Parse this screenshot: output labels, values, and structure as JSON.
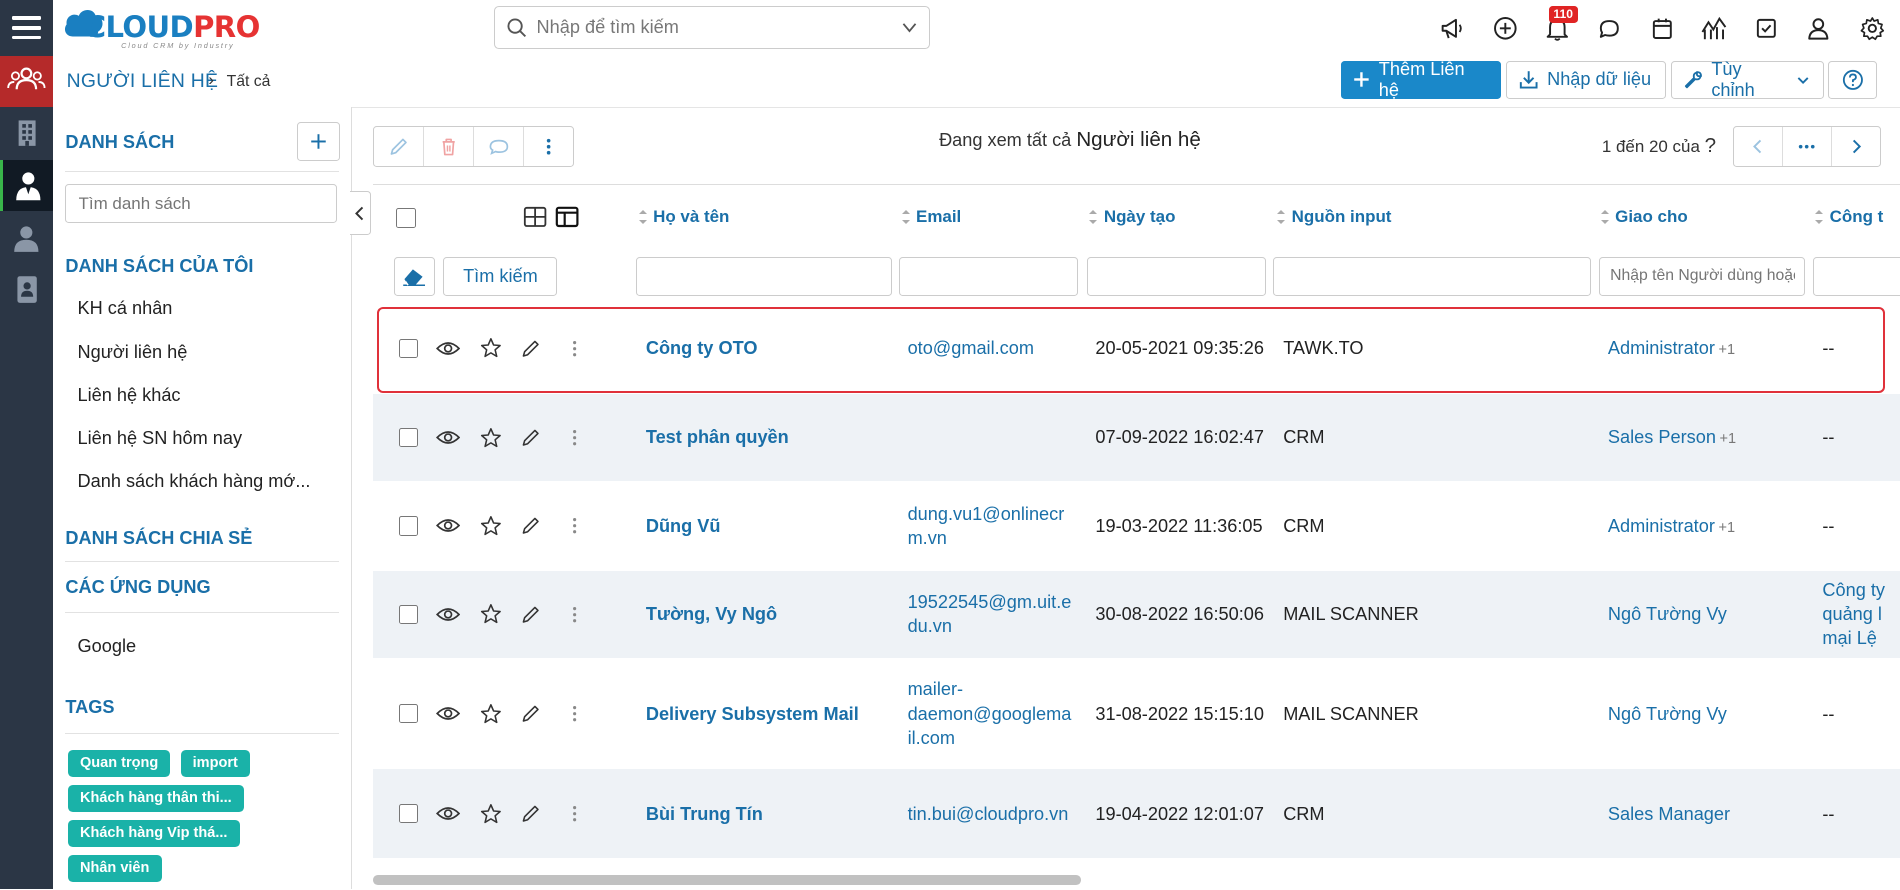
{
  "app": {
    "logo_cloud": "CLOUD",
    "logo_pro": "PRO",
    "logo_sub": "Cloud CRM by Industry",
    "brand_color": "#1a7fc1"
  },
  "topbar": {
    "search_placeholder": "Nhập để tìm kiếm",
    "notification_count": "110",
    "icons": [
      "megaphone-icon",
      "plus-circle-icon",
      "bell-icon",
      "chat-icon",
      "calendar-icon",
      "chart-icon",
      "checkbox-icon",
      "user-icon",
      "gear-icon"
    ]
  },
  "header": {
    "module": "NGƯỜI LIÊN HỆ",
    "separator": "›",
    "current": "Tất cả",
    "add_button": "Thêm Liên hệ",
    "import_button": "Nhập dữ liệu",
    "customize_button": "Tùy chỉnh"
  },
  "sidebar": {
    "list_title": "DANH SÁCH",
    "search_placeholder": "Tìm danh sách",
    "my_lists_title": "DANH SÁCH CỦA TÔI",
    "my_lists": [
      "KH cá nhân",
      "Người liên hệ",
      "Liên hệ khác",
      "Liên hệ SN hôm nay",
      "Danh sách khách hàng mớ..."
    ],
    "shared_title": "DANH SÁCH CHIA SẺ",
    "apps_title": "CÁC ỨNG DỤNG",
    "apps": [
      "Google"
    ],
    "tags_title": "TAGS",
    "tags": [
      "Quan trọng",
      "import",
      "Khách hàng thân thi...",
      "Khách hàng Vip thá...",
      "Nhân viên"
    ],
    "tag_color": "#1ab2a8"
  },
  "main": {
    "viewing_prefix": "Đang xem tất cả",
    "viewing_module": "Người liên hệ",
    "pager_text": "1 đến 20 của",
    "pager_help": "?",
    "columns": [
      "Họ và tên",
      "Email",
      "Ngày tạo",
      "Nguồn input",
      "Giao cho",
      "Công t"
    ],
    "filter_search_button": "Tìm kiếm",
    "filter_assignee_placeholder": "Nhập tên Người dùng hoặc",
    "rows": [
      {
        "name": "Công ty OTO",
        "email": [
          "oto@gmail.com"
        ],
        "created": "20-05-2021 09:35:26",
        "source": "TAWK.TO",
        "assignee": "Administrator",
        "assignee_extra": "+1",
        "company": [
          "--"
        ]
      },
      {
        "name": "Test phân quyền",
        "email": [],
        "created": "07-09-2022 16:02:47",
        "source": "CRM",
        "assignee": "Sales Person",
        "assignee_extra": "+1",
        "company": [
          "--"
        ]
      },
      {
        "name": "Dũng Vũ",
        "email": [
          "dung.vu1@onlinecr",
          "m.vn"
        ],
        "created": "19-03-2022 11:36:05",
        "source": "CRM",
        "assignee": "Administrator",
        "assignee_extra": "+1",
        "company": [
          "--"
        ]
      },
      {
        "name": "Tường, Vy Ngô",
        "email": [
          "19522545@gm.uit.e",
          "du.vn"
        ],
        "created": "30-08-2022 16:50:06",
        "source": "MAIL SCANNER",
        "assignee": "Ngô Tường Vy",
        "assignee_extra": "",
        "company": [
          "Công ty",
          "quảng l",
          "mại Lệ"
        ]
      },
      {
        "name": "Delivery Subsystem Mail",
        "email": [
          "mailer-",
          "daemon@googlema",
          "il.com"
        ],
        "created": "31-08-2022 15:15:10",
        "source": "MAIL SCANNER",
        "assignee": "Ngô Tường Vy",
        "assignee_extra": "",
        "company": [
          "--"
        ]
      },
      {
        "name": "Bùi Trung Tín",
        "email": [
          "tin.bui@cloudpro.vn"
        ],
        "created": "19-04-2022 12:01:07",
        "source": "CRM",
        "assignee": "Sales Manager",
        "assignee_extra": "",
        "company": [
          "--"
        ]
      }
    ],
    "highlight_color": "#e0313a"
  }
}
